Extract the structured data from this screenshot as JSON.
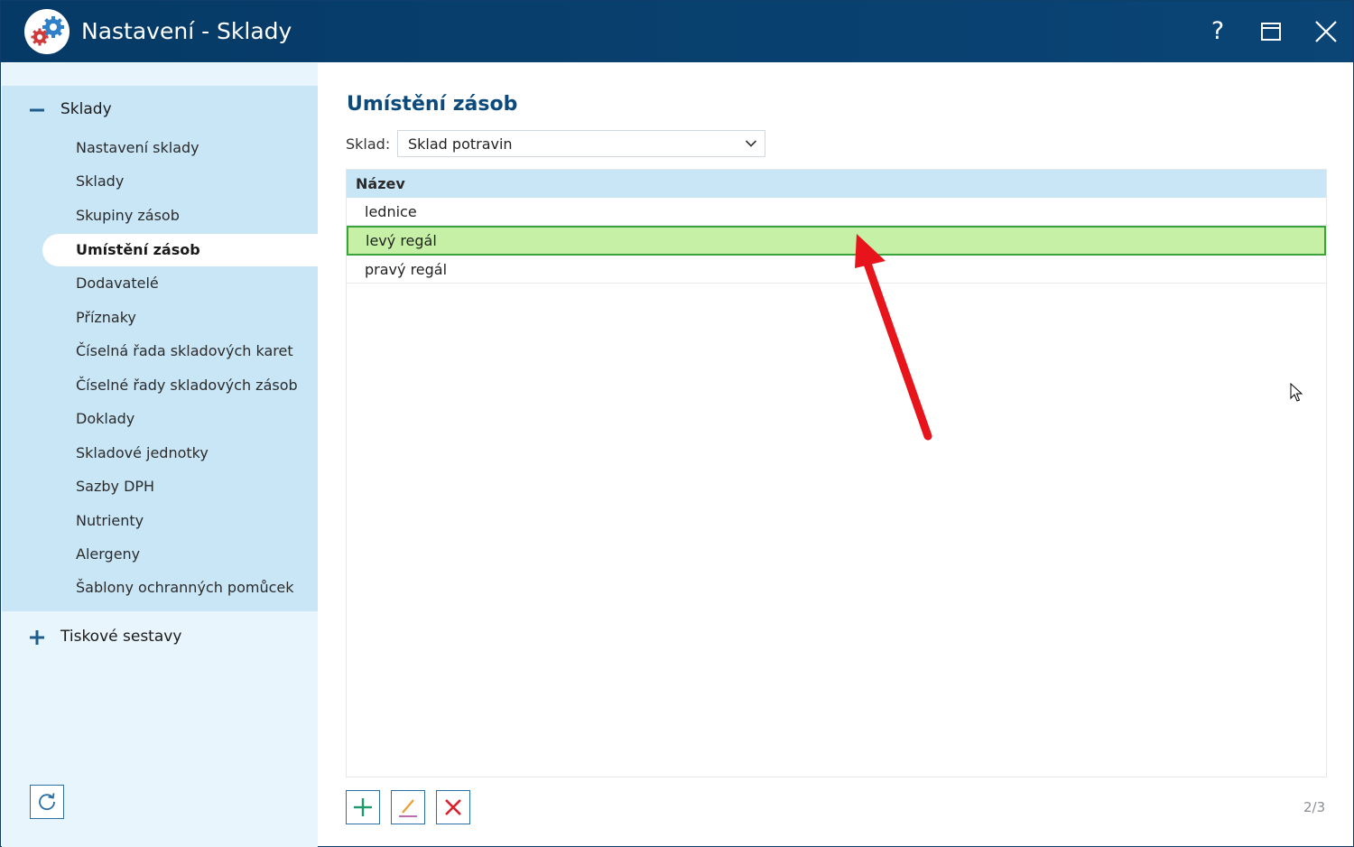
{
  "window": {
    "title": "Nastavení - Sklady",
    "help_label": "?"
  },
  "sidebar": {
    "groups": [
      {
        "label": "Sklady",
        "expanded": true,
        "items": [
          {
            "label": "Nastavení sklady"
          },
          {
            "label": "Sklady"
          },
          {
            "label": "Skupiny zásob"
          },
          {
            "label": "Umístění zásob",
            "active": true
          },
          {
            "label": "Dodavatelé"
          },
          {
            "label": "Příznaky"
          },
          {
            "label": "Číselná řada skladových karet"
          },
          {
            "label": "Číselné řady skladových zásob"
          },
          {
            "label": "Doklady"
          },
          {
            "label": "Skladové jednotky"
          },
          {
            "label": "Sazby DPH"
          },
          {
            "label": "Nutrienty"
          },
          {
            "label": "Alergeny"
          },
          {
            "label": "Šablony ochranných pomůcek"
          }
        ]
      },
      {
        "label": "Tiskové sestavy",
        "expanded": false
      }
    ]
  },
  "main": {
    "title": "Umístění zásob",
    "filter": {
      "label": "Sklad:",
      "selected": "Sklad potravin"
    },
    "table": {
      "header": "Název",
      "rows": [
        {
          "name": "lednice"
        },
        {
          "name": "levý regál",
          "selected": true
        },
        {
          "name": "pravý regál"
        }
      ]
    },
    "pager": "2/3"
  },
  "colors": {
    "titlebar": "#063a66",
    "sidebar_group": "#c9e6f7",
    "sidebar_bg": "#e9f5fd",
    "accent_title": "#0c4a7c",
    "selected_row": "#c6f0a6",
    "selected_border": "#3ca33c",
    "add": "#1f9a6b",
    "edit": "#e8a030",
    "delete": "#d8232a",
    "annotation_arrow": "#e8141c"
  },
  "icons": {
    "logo": "gears-icon",
    "help": "help-icon",
    "maximize": "maximize-icon",
    "close": "close-icon",
    "collapse": "minus-icon",
    "expand": "plus-icon",
    "dropdown": "chevron-down-icon",
    "refresh": "refresh-icon",
    "add": "plus-icon",
    "edit": "pencil-icon",
    "delete": "x-icon",
    "cursor": "mouse-pointer-icon"
  }
}
